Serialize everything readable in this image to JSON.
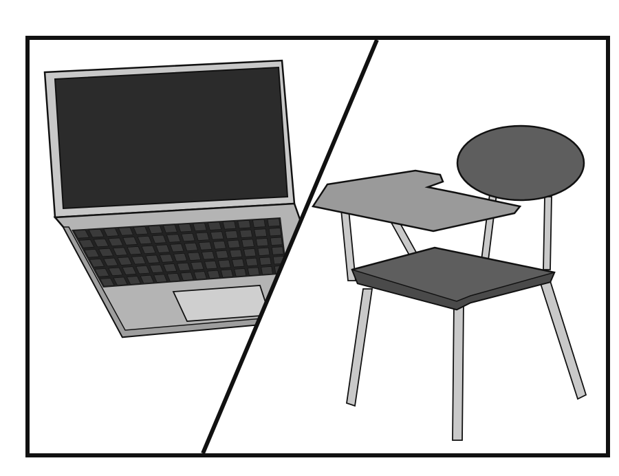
{
  "illustration": {
    "left_panel": {
      "subject": "laptop-icon"
    },
    "right_panel": {
      "subject": "school-desk-chair-icon"
    }
  },
  "colors": {
    "background": "#ffffff",
    "outline": "#111111",
    "screen": "#2b2b2b",
    "laptop_body": "#b4b4b4",
    "laptop_bezel": "#c8c8c8",
    "keys": "#3a3a3a",
    "trackpad": "#cfcfcf",
    "desk_surface": "#9a9a9a",
    "seat_back": "#5e5e5e",
    "legs": "#c9c9c9"
  }
}
